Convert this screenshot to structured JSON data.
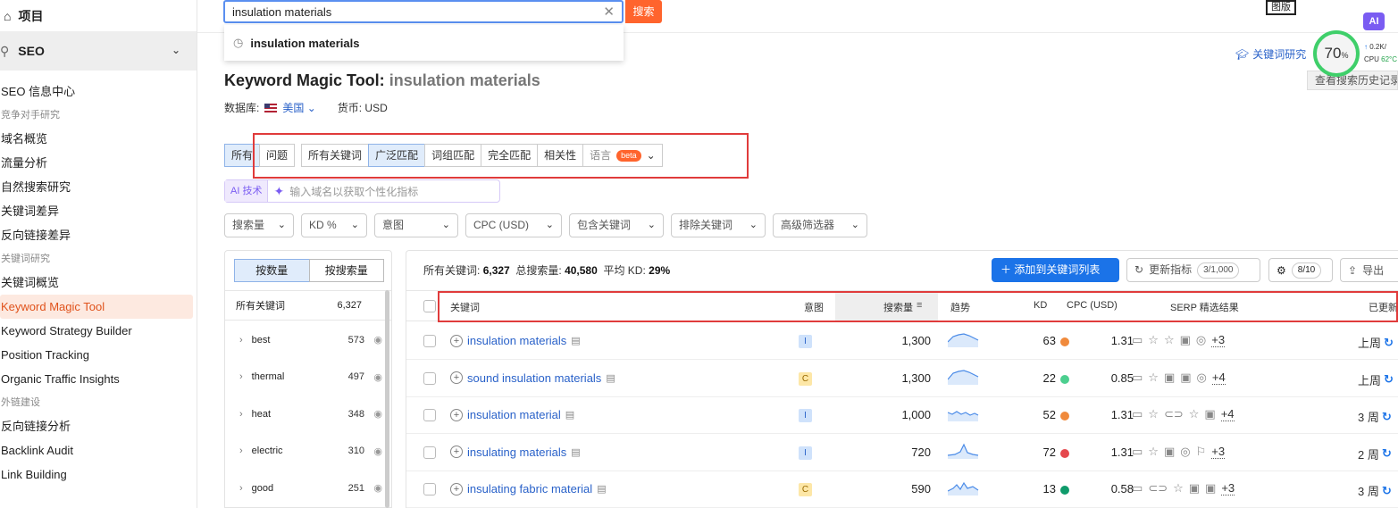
{
  "sidebar": {
    "project_label": "项目",
    "seo_label": "SEO",
    "items": [
      {
        "type": "item",
        "label": "SEO 信息中心"
      },
      {
        "type": "head",
        "label": "竞争对手研究"
      },
      {
        "type": "item",
        "label": "域名概览"
      },
      {
        "type": "item",
        "label": "流量分析"
      },
      {
        "type": "item",
        "label": "自然搜索研究"
      },
      {
        "type": "item",
        "label": "关键词差异"
      },
      {
        "type": "item",
        "label": "反向链接差异"
      },
      {
        "type": "head",
        "label": "关键词研究"
      },
      {
        "type": "item",
        "label": "关键词概览"
      },
      {
        "type": "item",
        "label": "Keyword Magic Tool",
        "active": true
      },
      {
        "type": "item",
        "label": "Keyword Strategy Builder"
      },
      {
        "type": "item",
        "label": "Position Tracking"
      },
      {
        "type": "item",
        "label": "Organic Traffic Insights"
      },
      {
        "type": "head",
        "label": "外链建设"
      },
      {
        "type": "item",
        "label": "反向链接分析"
      },
      {
        "type": "item",
        "label": "Backlink Audit"
      },
      {
        "type": "item",
        "label": "Link Building"
      }
    ]
  },
  "search": {
    "value": "insulation materials",
    "button": "搜索",
    "suggestion": "insulation materials"
  },
  "top_right": {
    "badge": "图版",
    "ai": "AI",
    "kwr_link": "关键词研究",
    "gauge_value": "70",
    "gauge_unit": "%",
    "cpu_top": "0.2K/",
    "cpu_label": "CPU",
    "cpu_value": "62°C",
    "history_btn": "查看搜索历史记录"
  },
  "header": {
    "title_prefix": "Keyword Magic Tool:",
    "title_query": "insulation materials",
    "db_label": "数据库:",
    "db_value": "美国",
    "currency": "货币: USD"
  },
  "tabs": {
    "all": "所有",
    "questions": "问题",
    "all_keywords": "所有关键词",
    "broad": "广泛匹配",
    "phrase": "词组匹配",
    "exact": "完全匹配",
    "related": "相关性",
    "language": "语言",
    "beta": "beta"
  },
  "ai_row": {
    "label": "AI 技术",
    "placeholder": "输入域名以获取个性化指标"
  },
  "filters": [
    "搜索量",
    "KD %",
    "意图",
    "CPC (USD)",
    "包含关键词",
    "排除关键词",
    "高级筛选器"
  ],
  "left_panel": {
    "toggle_on": "按数量",
    "toggle_off": "按搜索量",
    "head_label": "所有关键词",
    "head_count": "6,327",
    "groups": [
      {
        "name": "best",
        "count": "573"
      },
      {
        "name": "thermal",
        "count": "497"
      },
      {
        "name": "heat",
        "count": "348"
      },
      {
        "name": "electric",
        "count": "310"
      },
      {
        "name": "good",
        "count": "251"
      }
    ]
  },
  "main": {
    "stats_label1": "所有关键词:",
    "stats_val1": "6,327",
    "stats_label2": "总搜索量:",
    "stats_val2": "40,580",
    "stats_label3": "平均 KD:",
    "stats_val3": "29%",
    "add_btn": "添加到关键词列表",
    "update_btn": "更新指标",
    "update_count": "3/1,000",
    "settings_count": "8/10",
    "export_btn": "导出",
    "columns": {
      "keyword": "关键词",
      "intent": "意图",
      "volume": "搜索量",
      "trend": "趋势",
      "kd": "KD",
      "cpc": "CPC (USD)",
      "serp": "SERP 精选结果",
      "updated": "已更新"
    },
    "rows": [
      {
        "keyword": "insulation materials",
        "intent": "I",
        "volume": "1,300",
        "kd": "63",
        "kd_color": "#f08a3c",
        "cpc": "1.31",
        "serp_more": "+3",
        "updated": "上周"
      },
      {
        "keyword": "sound insulation materials",
        "intent": "C",
        "volume": "1,300",
        "kd": "22",
        "kd_color": "#4ccf8f",
        "cpc": "0.85",
        "serp_more": "+4",
        "updated": "上周"
      },
      {
        "keyword": "insulation material",
        "intent": "I",
        "volume": "1,000",
        "kd": "52",
        "kd_color": "#f08a3c",
        "cpc": "1.31",
        "serp_more": "+4",
        "updated": "3 周"
      },
      {
        "keyword": "insulating materials",
        "intent": "I",
        "volume": "720",
        "kd": "72",
        "kd_color": "#e5484d",
        "cpc": "1.31",
        "serp_more": "+3",
        "updated": "2 周"
      },
      {
        "keyword": "insulating fabric material",
        "intent": "C",
        "volume": "590",
        "kd": "13",
        "kd_color": "#0f9b6b",
        "cpc": "0.58",
        "serp_more": "+3",
        "updated": "3 周"
      }
    ]
  }
}
